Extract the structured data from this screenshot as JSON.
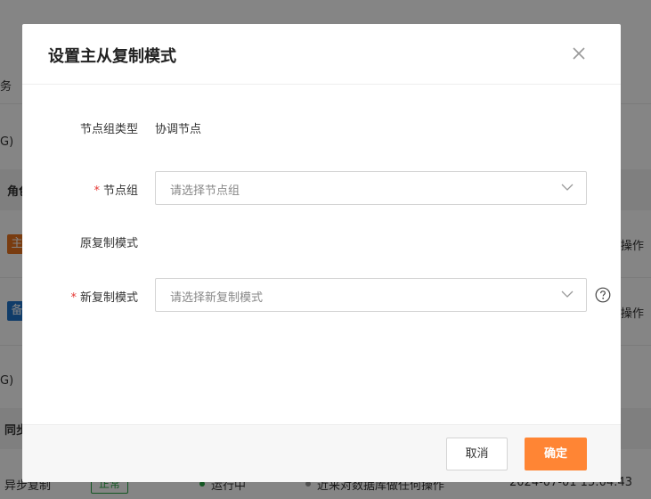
{
  "background": {
    "fragments": [
      "务",
      "G)",
      "角色",
      "主",
      "操作",
      "备",
      "操作",
      "G)",
      "同步",
      "异步复制",
      "正常",
      "运行中",
      "近来对数据库做任何操作",
      "2024-07-01 15:04:43"
    ]
  },
  "modal": {
    "title": "设置主从复制模式",
    "fields": {
      "node_group_type": {
        "label": "节点组类型",
        "value": "协调节点"
      },
      "node_group": {
        "required_mark": "*",
        "label": "节点组",
        "placeholder": "请选择节点组"
      },
      "original_mode": {
        "label": "原复制模式",
        "value": ""
      },
      "new_mode": {
        "required_mark": "*",
        "label": "新复制模式",
        "placeholder": "请选择新复制模式"
      }
    },
    "footer": {
      "cancel_label": "取消",
      "ok_label": "确定"
    }
  },
  "colors": {
    "primary": "#ff8534",
    "required": "#e53935",
    "tag_primary": "#e8741f",
    "tag_standby": "#1f73c9",
    "status_ok": "#27a844"
  }
}
